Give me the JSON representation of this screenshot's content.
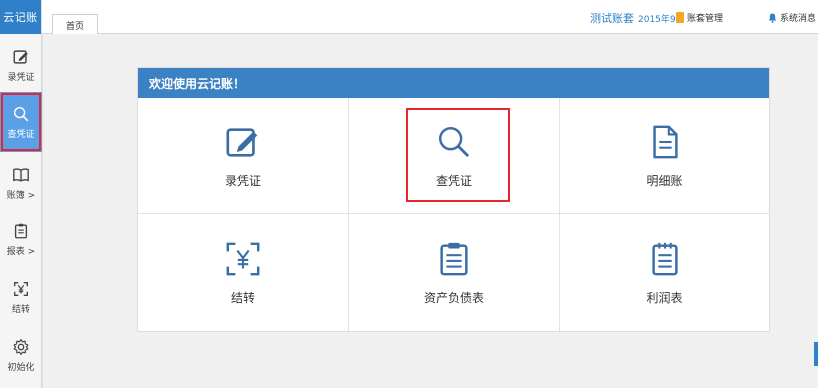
{
  "app": {
    "logo": "云记账"
  },
  "sidebar": {
    "items": [
      {
        "label": "录凭证",
        "icon": "edit-icon"
      },
      {
        "label": "查凭证",
        "icon": "search-icon",
        "active": true
      },
      {
        "label": "账簿 >",
        "icon": "book-icon"
      },
      {
        "label": "报表 >",
        "icon": "clipboard-icon"
      },
      {
        "label": "结转",
        "icon": "yen-frame-icon"
      },
      {
        "label": "初始化",
        "icon": "gear-icon"
      }
    ]
  },
  "header": {
    "tab": "首页",
    "account_name": "测试账套",
    "period": "2015年9月",
    "account_manage": "账套管理",
    "system_messages": "系统消息"
  },
  "main": {
    "welcome": "欢迎使用云记账！",
    "tiles": [
      {
        "label": "录凭证",
        "icon": "edit-icon"
      },
      {
        "label": "查凭证",
        "icon": "search-icon",
        "highlighted": true
      },
      {
        "label": "明细账",
        "icon": "document-icon"
      },
      {
        "label": "结转",
        "icon": "yen-frame-icon"
      },
      {
        "label": "资产负债表",
        "icon": "clipboard-icon"
      },
      {
        "label": "利润表",
        "icon": "notepad-icon"
      }
    ]
  },
  "colors": {
    "brand": "#2f80c8",
    "panel_header": "#3b82c4",
    "active_nav": "#5aa0e6",
    "highlight": "#e8262f",
    "icon": "#3a6ea5"
  }
}
